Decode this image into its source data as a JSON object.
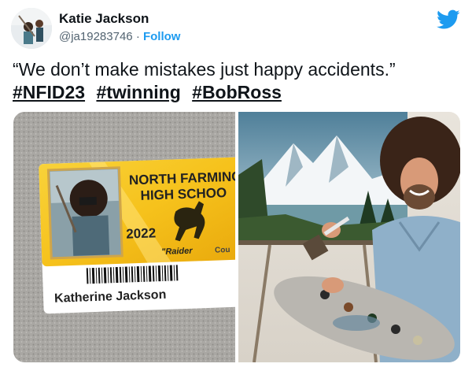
{
  "author": {
    "name": "Katie Jackson",
    "handle": "@ja19283746",
    "separator": "·",
    "follow_label": "Follow"
  },
  "tweet": {
    "text": "“We don’t make mistakes just happy accidents.”",
    "hashtags": [
      "#NFID23",
      "#twinning",
      "#BobRoss"
    ]
  },
  "id_card": {
    "school_line1": "NORTH FARMING",
    "school_line2": "HIGH SCHOO",
    "year": "2022",
    "mascot": "\"Raider",
    "partial_word": "Cou",
    "student_name": "Katherine Jackson"
  },
  "colors": {
    "link": "#1d9bf0",
    "card_yellow": "#f6c21c",
    "twitter_blue": "#1d9bf0"
  }
}
